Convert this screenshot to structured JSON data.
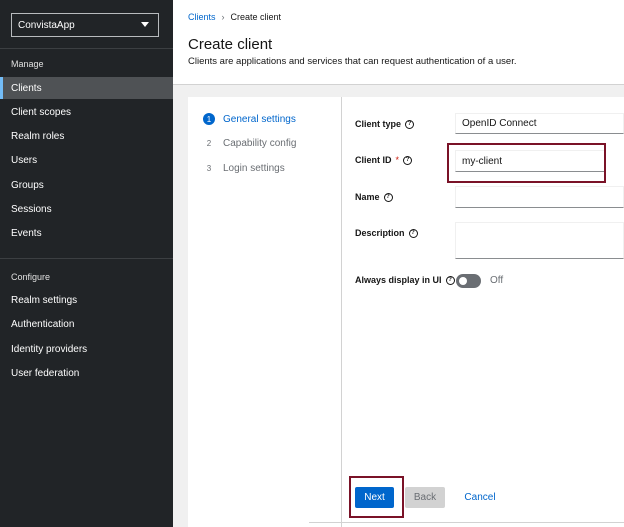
{
  "sidebar": {
    "realm": "ConvistaApp",
    "manage_label": "Manage",
    "manage_items": [
      "Clients",
      "Client scopes",
      "Realm roles",
      "Users",
      "Groups",
      "Sessions",
      "Events"
    ],
    "configure_label": "Configure",
    "configure_items": [
      "Realm settings",
      "Authentication",
      "Identity providers",
      "User federation"
    ]
  },
  "breadcrumb": {
    "parent": "Clients",
    "current": "Create client"
  },
  "page": {
    "title": "Create client",
    "description": "Clients are applications and services that can request authentication of a user."
  },
  "wizard": {
    "steps": [
      {
        "num": "1",
        "label": "General settings"
      },
      {
        "num": "2",
        "label": "Capability config"
      },
      {
        "num": "3",
        "label": "Login settings"
      }
    ]
  },
  "form": {
    "client_type_label": "Client type",
    "client_type_value": "OpenID Connect",
    "client_id_label": "Client ID",
    "client_id_required": "*",
    "client_id_value": "my-client",
    "name_label": "Name",
    "name_value": "",
    "description_label": "Description",
    "description_value": "",
    "always_display_label": "Always display in UI",
    "always_display_value": "Off"
  },
  "footer": {
    "next": "Next",
    "back": "Back",
    "cancel": "Cancel"
  },
  "colors": {
    "accent": "#0066cc",
    "sidebar_bg": "#212427",
    "highlight": "#7a1227"
  }
}
